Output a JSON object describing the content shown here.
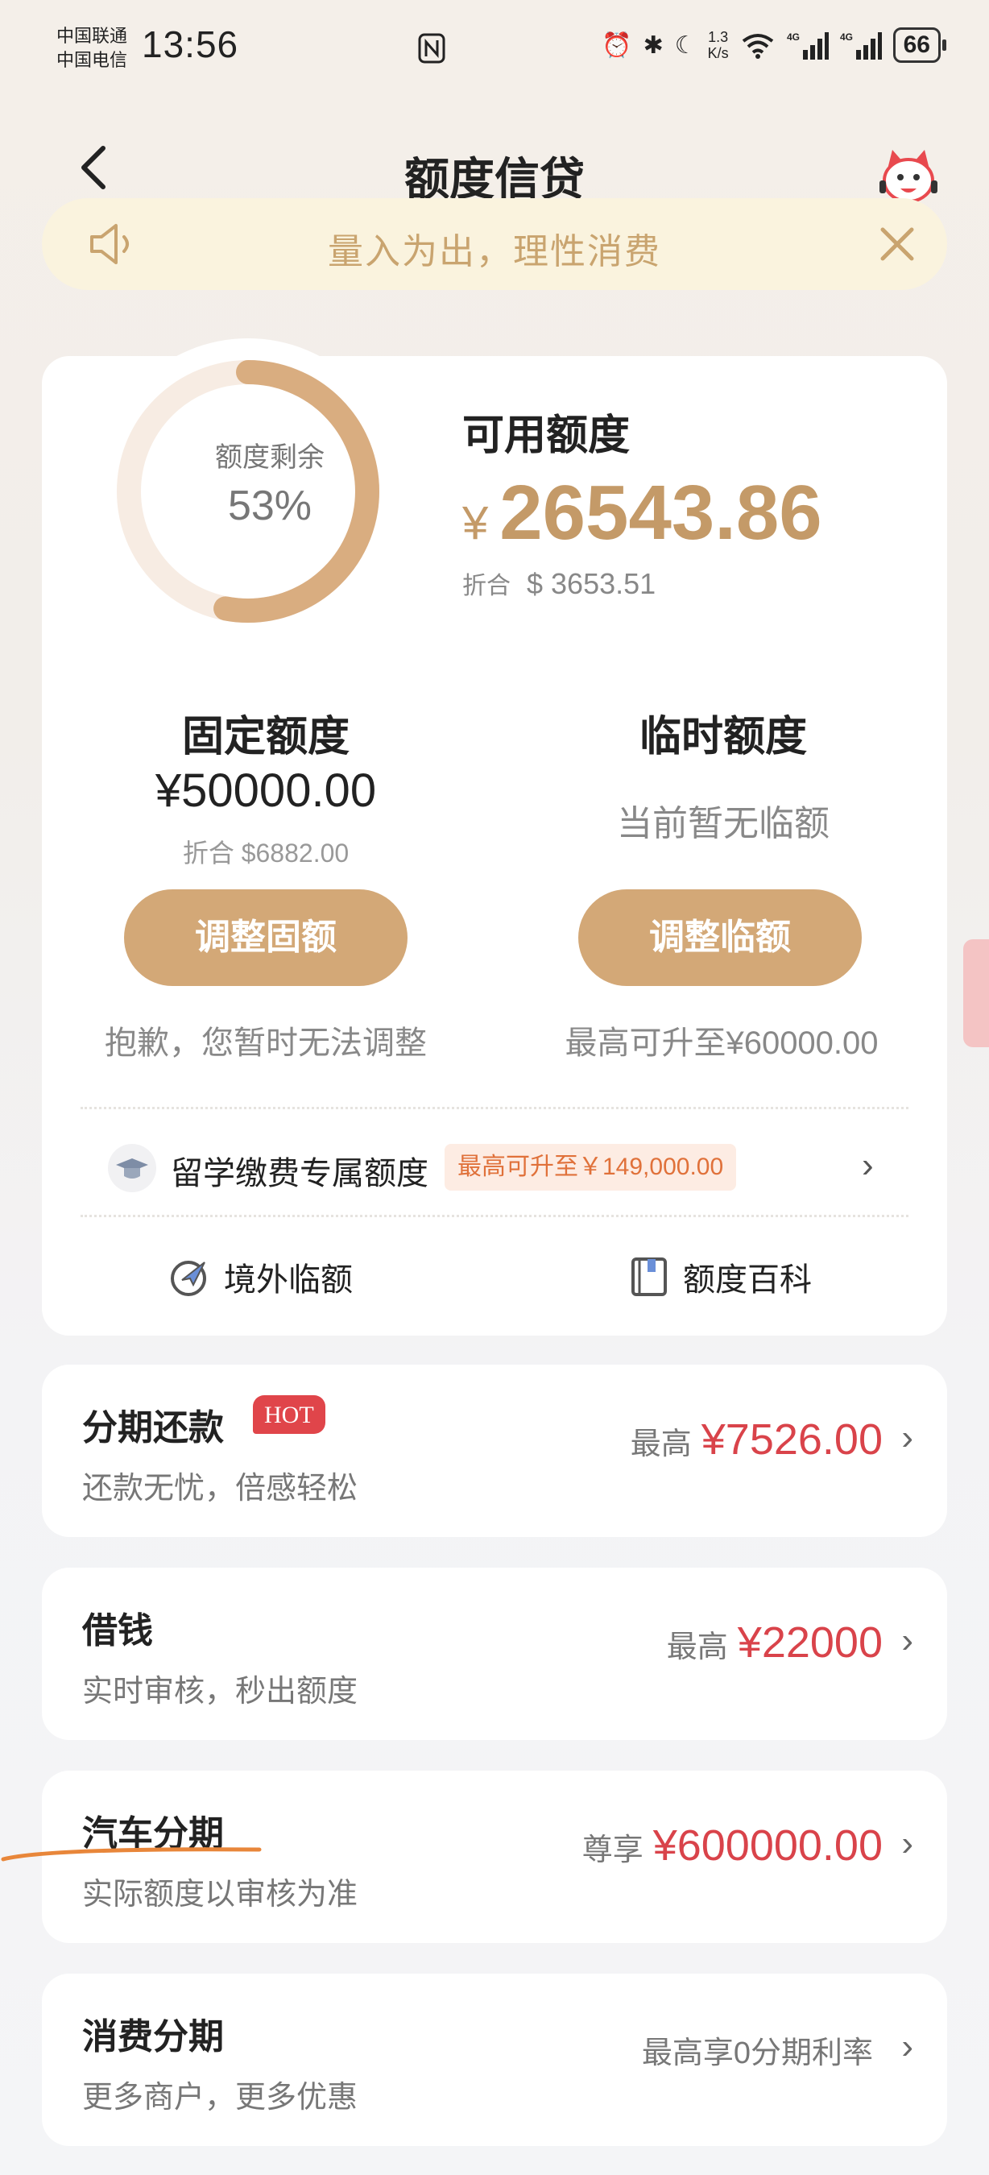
{
  "status_bar": {
    "carrier1": "中国联通",
    "carrier2": "中国电信",
    "time": "13:56",
    "net_speed_value": "1.3",
    "net_speed_unit": "K/s",
    "battery": "66"
  },
  "nav": {
    "title": "额度信贷"
  },
  "notice": {
    "text": "量入为出，理性消费"
  },
  "credit": {
    "ring_label": "额度剩余",
    "ring_percent_text": "53%",
    "ring_fraction": 0.53,
    "available_label": "可用额度",
    "currency": "¥",
    "available_amount": "26543.86",
    "conversion_prefix": "折合",
    "conversion_value": "$ 3653.51"
  },
  "fixed": {
    "title": "固定额度",
    "amount": "¥50000.00",
    "conversion": "折合 $6882.00",
    "button": "调整固额",
    "note": "抱歉，您暂时无法调整"
  },
  "temp": {
    "title": "临时额度",
    "status": "当前暂无临额",
    "button": "调整临额",
    "note": "最高可升至¥60000.00"
  },
  "study": {
    "text": "留学缴费专属额度",
    "tag": "最高可升至￥149,000.00"
  },
  "links": {
    "overseas": "境外临额",
    "encyclopedia": "额度百科"
  },
  "list": [
    {
      "title": "分期还款",
      "badge": "HOT",
      "subtitle": "还款无忧，倍感轻松",
      "prefix": "最高",
      "amount": "¥7526.00"
    },
    {
      "title": "借钱",
      "subtitle": "实时审核，秒出额度",
      "prefix": "最高",
      "amount": "¥22000"
    },
    {
      "title": "汽车分期",
      "subtitle": "实际额度以审核为准",
      "prefix": "尊享",
      "amount": "¥600000.00"
    },
    {
      "title": "消费分期",
      "subtitle": "更多商户，更多优惠",
      "prefix": "最高享0分期利率",
      "amount": ""
    }
  ],
  "colors": {
    "accent": "#c49a68",
    "button": "#d3a877",
    "price_red": "#d9434a",
    "notice_bg": "#faf3de",
    "annotation_underline": "#e8863a"
  }
}
